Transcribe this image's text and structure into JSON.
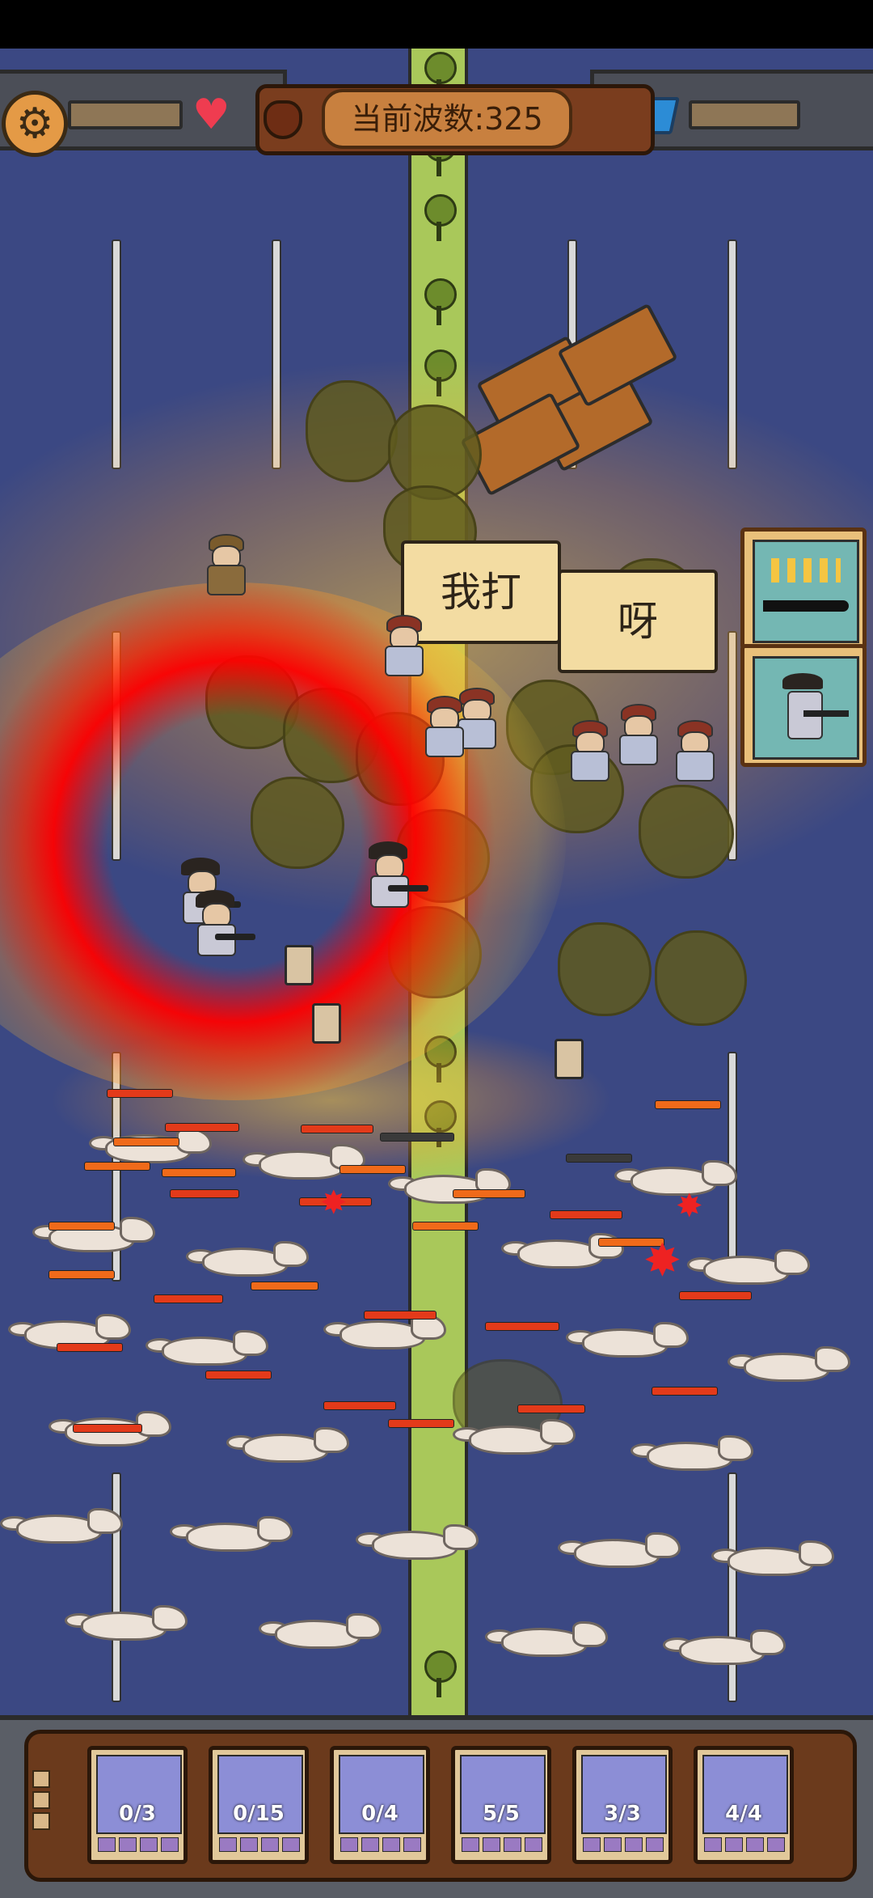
{
  "hud": {
    "wave_label": "当前波数:325",
    "settings_icon": "gear-icon",
    "life_icon": "heart-icon",
    "gem_icon": "gem-icon",
    "shield_icon": "shield-icon"
  },
  "speech_bubbles": [
    "我打",
    "呀"
  ],
  "skills": [
    {
      "name": "candles-sword-skill"
    },
    {
      "name": "gunman-skill"
    }
  ],
  "units": [
    {
      "name": "gunman-card",
      "count": "0/3"
    },
    {
      "name": "white-soldier-card",
      "count": "0/15"
    },
    {
      "name": "pistol-man-card",
      "count": "0/4"
    },
    {
      "name": "catapult-card",
      "count": "5/5"
    },
    {
      "name": "bandana-fighter-card",
      "count": "3/3"
    },
    {
      "name": "speaker-card",
      "count": "4/4"
    }
  ],
  "colors": {
    "field": "#3b4883",
    "median": "#a9c85a",
    "heat_ring": "#ff0000",
    "hp_bar": "#e33a1a"
  }
}
